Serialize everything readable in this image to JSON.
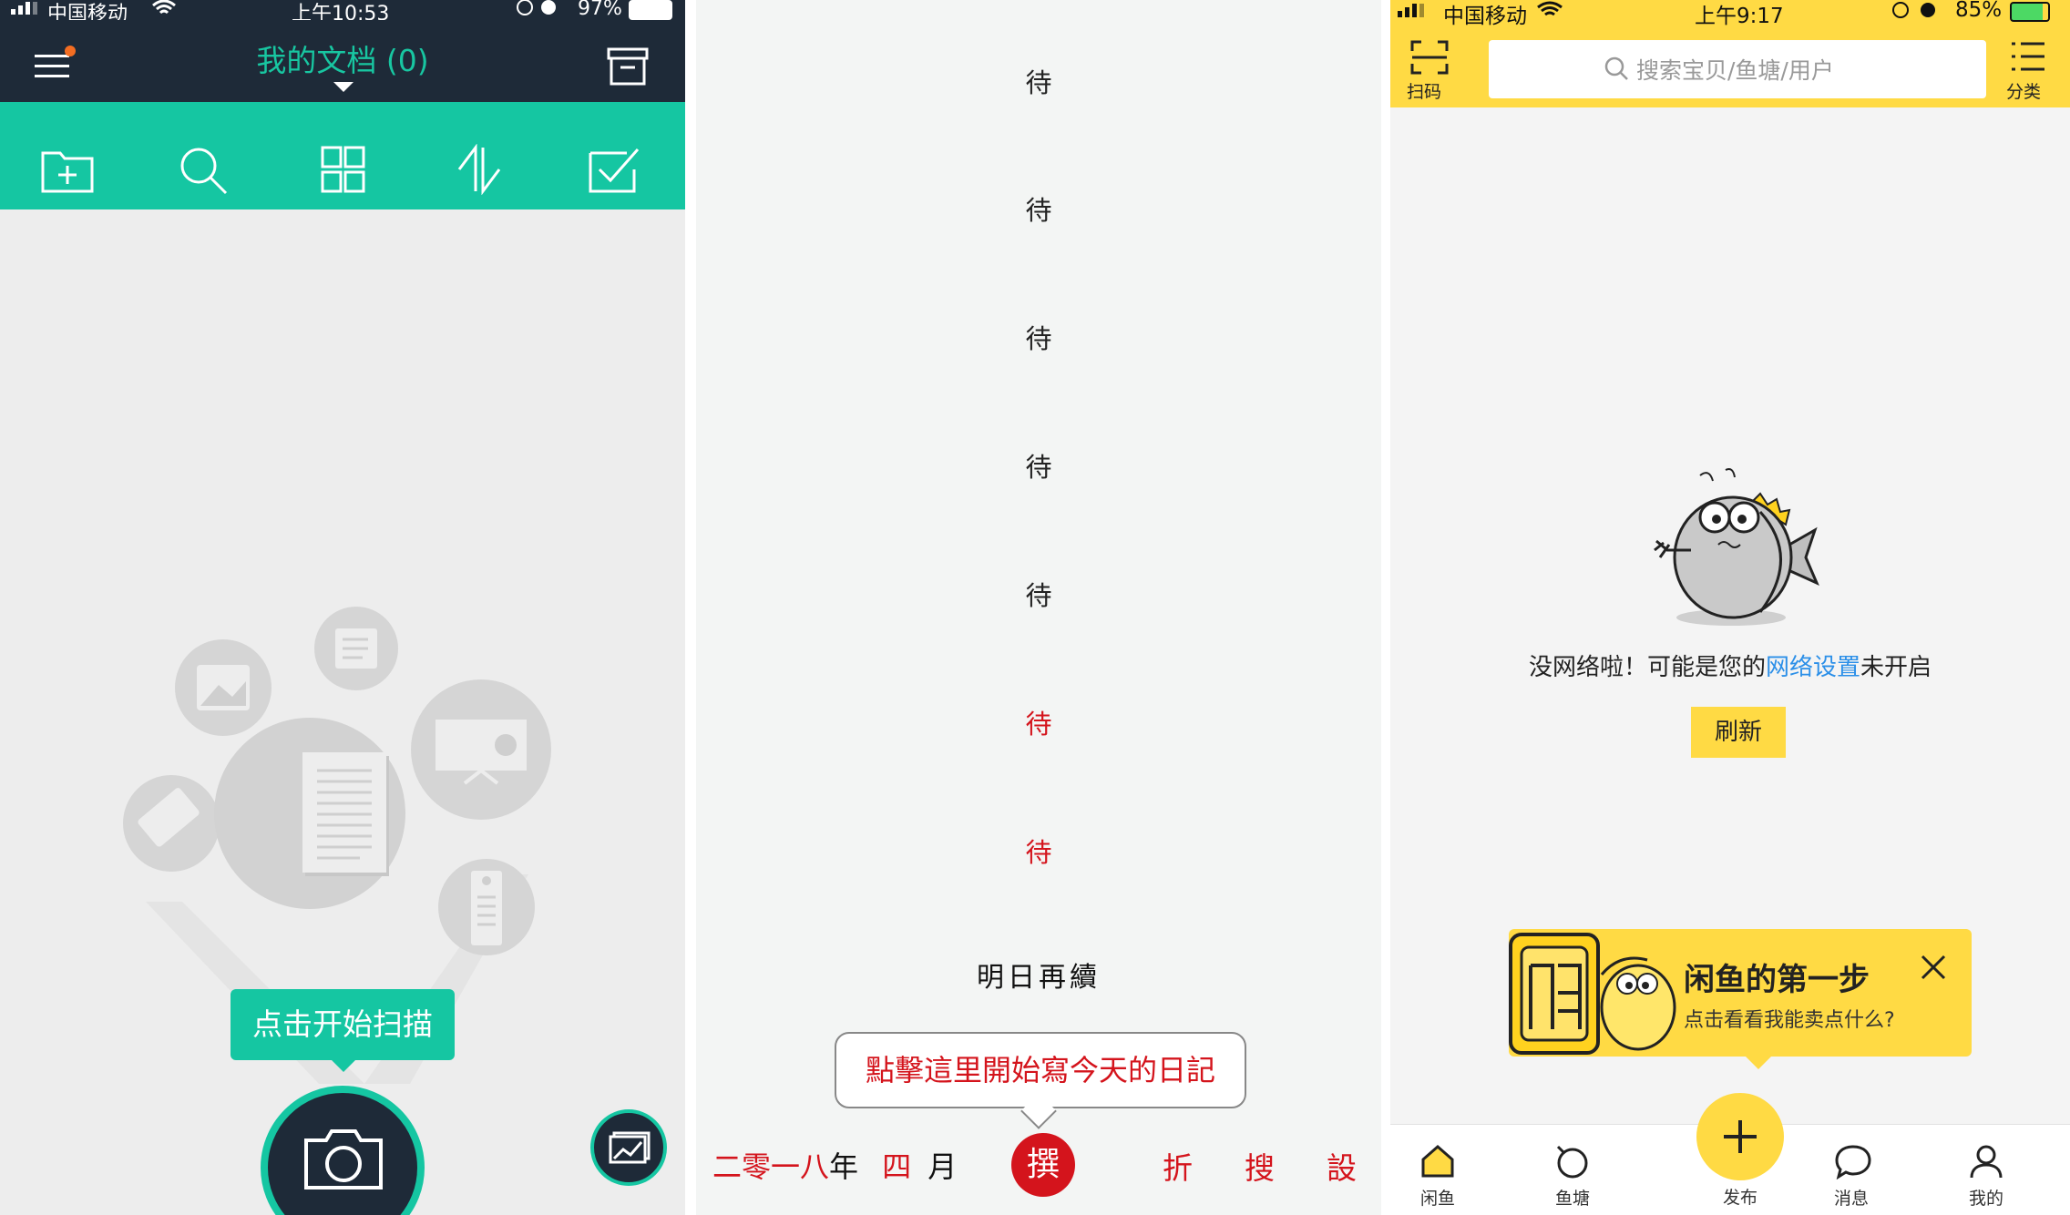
{
  "panel1": {
    "status": {
      "carrier": "中国移动",
      "time": "上午10:53",
      "battery": "97%"
    },
    "title": "我的文档 (0)",
    "toolbar_icons": [
      "add-folder-icon",
      "search-icon",
      "grid-view-icon",
      "sort-icon",
      "select-icon"
    ],
    "scan_tip": "点击开始扫描",
    "colors": {
      "nav": "#1e2a38",
      "accent": "#15c6a2"
    }
  },
  "panel2": {
    "wait_chars": [
      "待",
      "待",
      "待",
      "待",
      "待",
      "待",
      "待"
    ],
    "resume_text": "明日再續",
    "tip_text": "點擊這里開始寫今天的日記",
    "date": {
      "year": "二零一八",
      "year_unit": "年",
      "month": "四",
      "month_unit": "月"
    },
    "compose_label": "撰",
    "actions": [
      "折",
      "搜",
      "設"
    ],
    "colors": {
      "accent": "#d4141c"
    }
  },
  "panel3": {
    "status": {
      "carrier": "中国移动",
      "time": "上午9:17",
      "battery": "85%"
    },
    "scan_label": "扫码",
    "search_placeholder": "搜索宝贝/鱼塘/用户",
    "category_label": "分类",
    "offline_pre": "没网络啦！可能是您的",
    "offline_link": "网络设置",
    "offline_post": "未开启",
    "refresh_label": "刷新",
    "promo_title": "闲鱼的第一步",
    "promo_sub": "点击看看我能卖点什么?",
    "tabs": [
      {
        "label": "闲鱼",
        "icon": "home-icon"
      },
      {
        "label": "鱼塘",
        "icon": "pond-icon"
      },
      {
        "label": "发布",
        "icon": "plus-icon"
      },
      {
        "label": "消息",
        "icon": "message-icon"
      },
      {
        "label": "我的",
        "icon": "profile-icon"
      }
    ],
    "colors": {
      "brand": "#ffda44",
      "link": "#2b8fe8"
    }
  }
}
